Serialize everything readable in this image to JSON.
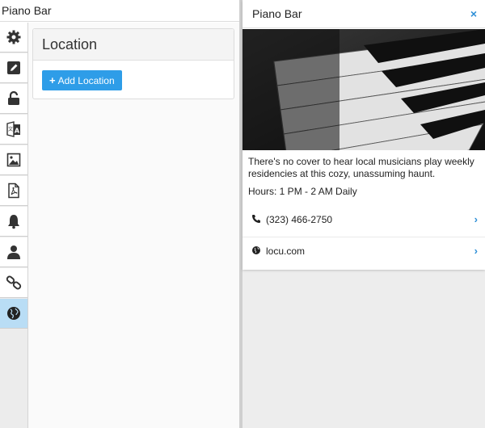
{
  "left": {
    "title": "Piano Bar",
    "sidebar_icons": [
      "gear-icon",
      "pencil-icon",
      "unlock-icon",
      "translate-icon",
      "image-icon",
      "pdf-icon",
      "bell-icon",
      "user-icon",
      "link-icon",
      "globe-icon"
    ],
    "active_icon": "globe-icon",
    "location": {
      "heading": "Location",
      "add_button_label": "Add Location"
    }
  },
  "right": {
    "title": "Piano Bar",
    "close_label": "×",
    "description": "There's no cover to hear local musicians play weekly residencies at this cozy, unassuming haunt.",
    "hours": "Hours: 1 PM - 2 AM Daily",
    "phone": "(323) 466-2750",
    "website": "locu.com"
  },
  "colors": {
    "accent": "#2e9de8",
    "active_tab": "#b9ddf5"
  }
}
